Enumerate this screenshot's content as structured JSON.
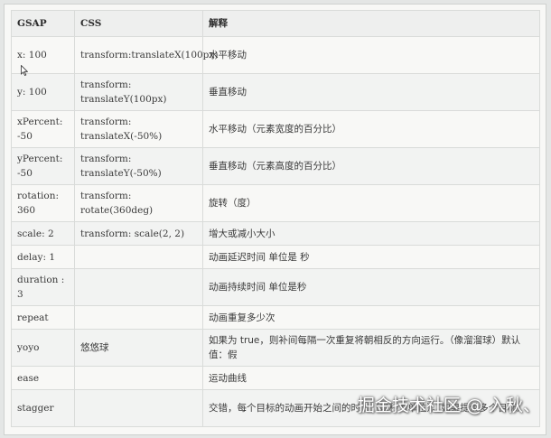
{
  "table": {
    "headers": [
      "GSAP",
      "CSS",
      "解释"
    ],
    "rows": [
      {
        "gsap": "x: 100",
        "css": "transform:translateX(100px)",
        "desc": "水平移动"
      },
      {
        "gsap": "y: 100",
        "css": "transform: translateY(100px)",
        "desc": "垂直移动"
      },
      {
        "gsap": "xPercent: -50",
        "css": "transform: translateX(-50%)",
        "desc": "水平移动（元素宽度的百分比）"
      },
      {
        "gsap": "yPercent: -50",
        "css": "transform: translateY(-50%)",
        "desc": "垂直移动（元素高度的百分比）"
      },
      {
        "gsap": "rotation: 360",
        "css": "transform: rotate(360deg)",
        "desc": "旋转（度）"
      },
      {
        "gsap": "scale: 2",
        "css": "transform: scale(2, 2)",
        "desc": "增大或减小大小"
      },
      {
        "gsap": "delay: 1",
        "css": "",
        "desc": "动画延迟时间 单位是 秒"
      },
      {
        "gsap": "duration : 3",
        "css": "",
        "desc": "动画持续时间 单位是秒"
      },
      {
        "gsap": "repeat",
        "css": "",
        "desc": "动画重复多少次"
      },
      {
        "gsap": "yoyo",
        "css": "悠悠球",
        "desc": "如果为 true，则补间每隔一次重复将朝相反的方向运行。（像溜溜球）默认值：假"
      },
      {
        "gsap": "ease",
        "css": "",
        "desc": "运动曲线"
      },
      {
        "gsap": "stagger",
        "css": "",
        "desc": "交错，每个目标的动画开始之间的时间（以秒为单位）。如果提供多个目标）"
      }
    ]
  },
  "watermark": "掘金技术社区 @ 入秋、"
}
